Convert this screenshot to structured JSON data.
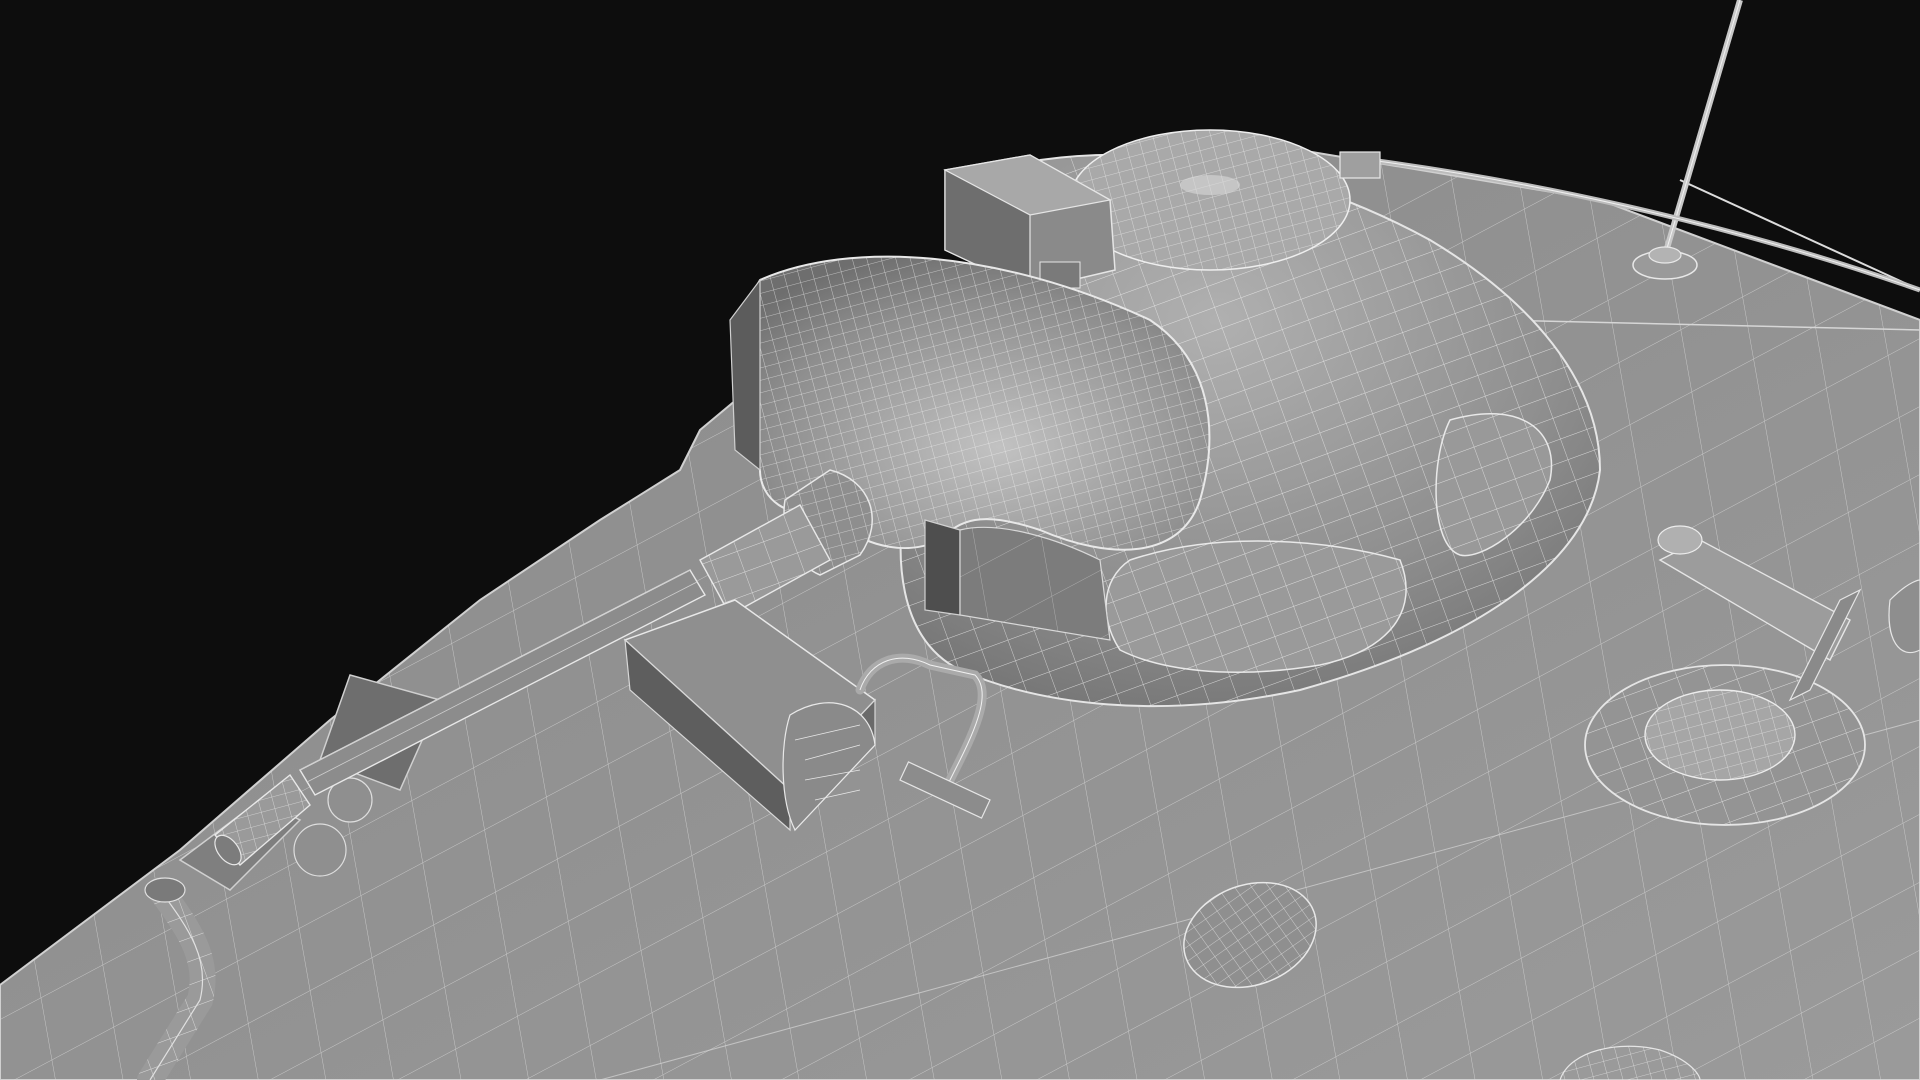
{
  "viewport": {
    "background_color": "#0d0d0d",
    "model_fill_color": "#8c8c8c",
    "wire_color": "#e6e6e6",
    "shadow_color": "#5a5a5a"
  },
  "scene": {
    "subject": "tank-turret-wireframe-render",
    "visible_parts": [
      "hull-top-deck",
      "turret-dome",
      "gun-mantlet",
      "main-gun-barrel",
      "muzzle-brake",
      "storage-box",
      "periscope-block",
      "radio-antenna",
      "hatch-ring",
      "grab-handle",
      "headlight-dome",
      "exhaust-pipe"
    ]
  }
}
